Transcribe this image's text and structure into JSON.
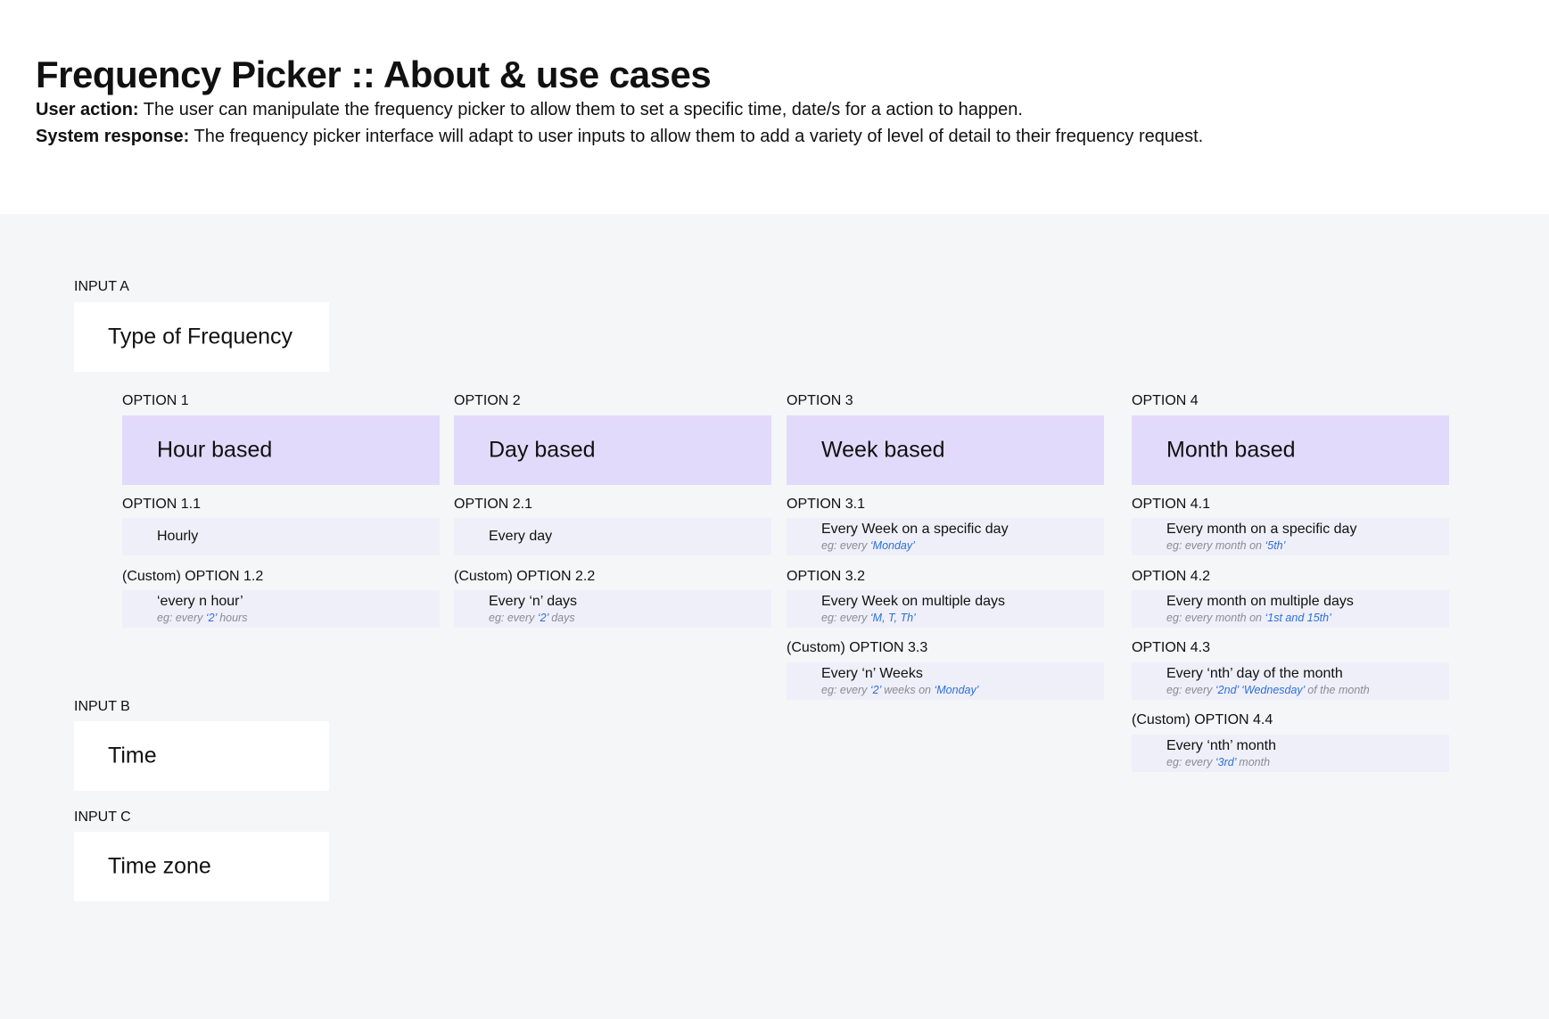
{
  "header": {
    "title": "Frequency Picker :: About & use cases",
    "user_action_label": "User action:",
    "user_action_text": " The user can manipulate the frequency picker to allow them to set a specific time, date/s for a action to happen.",
    "system_response_label": "System response:",
    "system_response_text": " The frequency picker interface will adapt to user inputs to allow them to add a variety of level of detail to their frequency request."
  },
  "inputs": [
    {
      "tag": "INPUT A",
      "label": "Type of Frequency"
    },
    {
      "tag": "INPUT B",
      "label": "Time"
    },
    {
      "tag": "INPUT C",
      "label": "Time zone"
    }
  ],
  "options": [
    {
      "tag": "OPTION 1",
      "label": "Hour based",
      "subs": [
        {
          "tag": "OPTION 1.1",
          "title": "Hourly"
        },
        {
          "tag": "(Custom) OPTION 1.2",
          "title": "‘every n hour’",
          "eg": [
            [
              "eg: every ",
              0
            ],
            [
              "‘2’",
              1
            ],
            [
              " hours",
              0
            ]
          ]
        }
      ]
    },
    {
      "tag": "OPTION 2",
      "label": "Day based",
      "subs": [
        {
          "tag": "OPTION 2.1",
          "title": "Every day"
        },
        {
          "tag": "(Custom) OPTION 2.2",
          "title": "Every ‘n’ days",
          "eg": [
            [
              "eg: every ",
              0
            ],
            [
              "‘2’",
              1
            ],
            [
              " days",
              0
            ]
          ]
        }
      ]
    },
    {
      "tag": "OPTION 3",
      "label": "Week based",
      "subs": [
        {
          "tag": "OPTION 3.1",
          "title": "Every Week on a specific day",
          "eg": [
            [
              "eg: every ",
              0
            ],
            [
              "‘Monday’",
              1
            ]
          ]
        },
        {
          "tag": "OPTION 3.2",
          "title": "Every Week on multiple days",
          "eg": [
            [
              "eg: every ",
              0
            ],
            [
              "‘M, T, Th’",
              1
            ]
          ]
        },
        {
          "tag": "(Custom) OPTION 3.3",
          "title": "Every ‘n’ Weeks",
          "eg": [
            [
              "eg: every ",
              0
            ],
            [
              "‘2’",
              1
            ],
            [
              " weeks on ",
              0
            ],
            [
              "‘Monday’",
              1
            ]
          ]
        }
      ]
    },
    {
      "tag": "OPTION 4",
      "label": "Month based",
      "subs": [
        {
          "tag": "OPTION 4.1",
          "title": "Every month on a specific day",
          "eg": [
            [
              "eg: every month on ",
              0
            ],
            [
              "‘5th’",
              1
            ]
          ]
        },
        {
          "tag": "OPTION 4.2",
          "title": "Every month on multiple days",
          "eg": [
            [
              "eg: every month on ",
              0
            ],
            [
              "‘1st and 15th’",
              1
            ]
          ]
        },
        {
          "tag": "OPTION 4.3",
          "title": "Every ‘nth’ day of the month",
          "eg": [
            [
              "eg: every ",
              0
            ],
            [
              "‘2nd’",
              1
            ],
            [
              " ",
              0
            ],
            [
              "‘Wednesday’",
              1
            ],
            [
              " of the month",
              0
            ]
          ]
        },
        {
          "tag": "(Custom) OPTION 4.4",
          "title": "Every ‘nth’ month",
          "eg": [
            [
              "eg: every ",
              0
            ],
            [
              "‘3rd’",
              1
            ],
            [
              " month",
              0
            ]
          ]
        }
      ]
    }
  ],
  "colors": {
    "option_card_bg": "#e2dafa",
    "sub_card_bg": "#efeff9",
    "canvas_bg": "#f5f6f8",
    "highlight": "#2b6fd8",
    "muted": "#8b8b93"
  }
}
